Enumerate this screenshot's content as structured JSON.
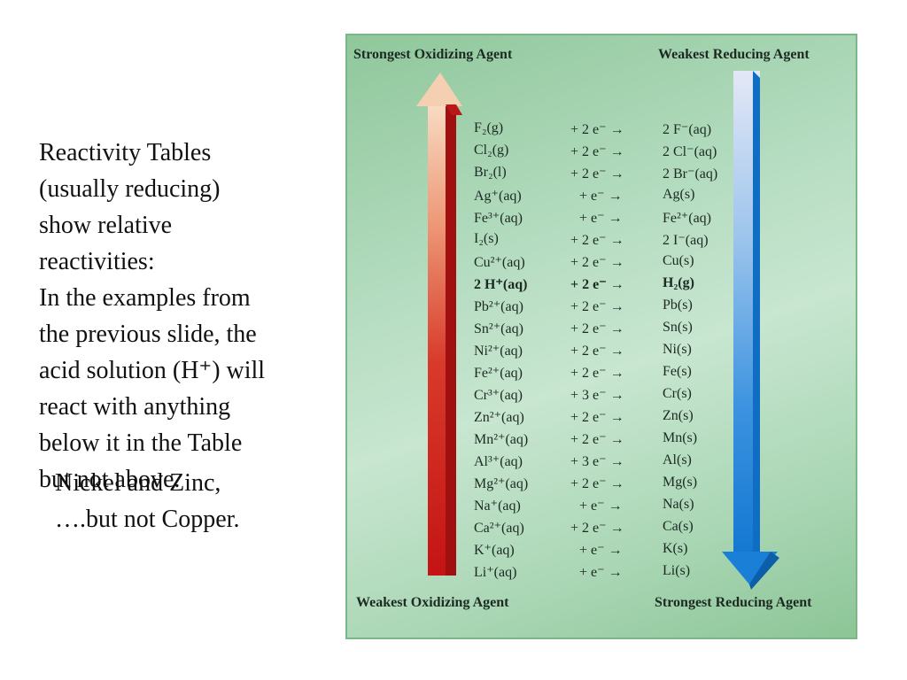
{
  "left_text": {
    "lines": [
      "Reactivity Tables",
      "(usually reducing)",
      "show relative",
      "reactivities:",
      "In the examples from",
      "the previous slide, the",
      "acid solution (H⁺) will",
      "react with anything",
      "below it in the Table",
      "but not above."
    ],
    "overlay_line1": "Nickel and Zinc,",
    "overlay_line2": "….but not Copper."
  },
  "figure": {
    "top_left_label": "Strongest Oxidizing Agent",
    "top_right_label": "Weakest Reducing Agent",
    "bottom_left_label": "Weakest Oxidizing Agent",
    "bottom_right_label": "Strongest Reducing Agent",
    "colors": {
      "oxidizing_arrow": "#cc1e1e",
      "reducing_arrow": "#1a7fd6",
      "background": "#b4dcc0"
    },
    "rows": [
      {
        "ox": "F₂(g)",
        "e": "+ 2 e⁻ →",
        "red": "2 F⁻(aq)"
      },
      {
        "ox": "Cl₂(g)",
        "e": "+ 2 e⁻ →",
        "red": "2 Cl⁻(aq)"
      },
      {
        "ox": "Br₂(l)",
        "e": "+ 2 e⁻ →",
        "red": "2 Br⁻(aq)"
      },
      {
        "ox": "Ag⁺(aq)",
        "e": "+ e⁻ →",
        "red": "Ag(s)"
      },
      {
        "ox": "Fe³⁺(aq)",
        "e": "+ e⁻ →",
        "red": "Fe²⁺(aq)"
      },
      {
        "ox": "I₂(s)",
        "e": "+ 2 e⁻ →",
        "red": "2 I⁻(aq)"
      },
      {
        "ox": "Cu²⁺(aq)",
        "e": "+ 2 e⁻ →",
        "red": "Cu(s)"
      },
      {
        "ox": "2 H⁺(aq)",
        "e": "+ 2 e⁻ →",
        "red": "H₂(g)",
        "bold": true
      },
      {
        "ox": "Pb²⁺(aq)",
        "e": "+ 2 e⁻ →",
        "red": "Pb(s)"
      },
      {
        "ox": "Sn²⁺(aq)",
        "e": "+ 2 e⁻ →",
        "red": "Sn(s)"
      },
      {
        "ox": "Ni²⁺(aq)",
        "e": "+ 2 e⁻ →",
        "red": "Ni(s)"
      },
      {
        "ox": "Fe²⁺(aq)",
        "e": "+ 2 e⁻ →",
        "red": "Fe(s)"
      },
      {
        "ox": "Cr³⁺(aq)",
        "e": "+ 3 e⁻ →",
        "red": "Cr(s)"
      },
      {
        "ox": "Zn²⁺(aq)",
        "e": "+ 2 e⁻ →",
        "red": "Zn(s)"
      },
      {
        "ox": "Mn²⁺(aq)",
        "e": "+ 2 e⁻ →",
        "red": "Mn(s)"
      },
      {
        "ox": "Al³⁺(aq)",
        "e": "+ 3 e⁻ →",
        "red": "Al(s)"
      },
      {
        "ox": "Mg²⁺(aq)",
        "e": "+ 2 e⁻ →",
        "red": "Mg(s)"
      },
      {
        "ox": "Na⁺(aq)",
        "e": "+ e⁻ →",
        "red": "Na(s)"
      },
      {
        "ox": "Ca²⁺(aq)",
        "e": "+ 2 e⁻ →",
        "red": "Ca(s)"
      },
      {
        "ox": "K⁺(aq)",
        "e": "+ e⁻ →",
        "red": "K(s)"
      },
      {
        "ox": "Li⁺(aq)",
        "e": "+ e⁻ →",
        "red": "Li(s)"
      }
    ]
  }
}
